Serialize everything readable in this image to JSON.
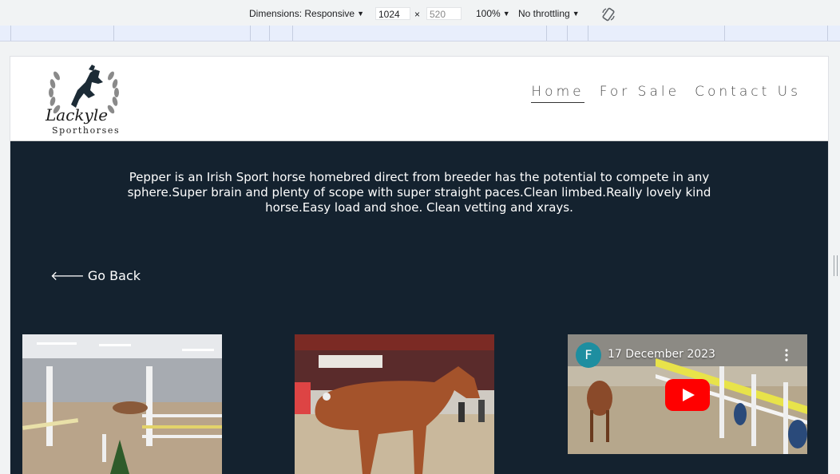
{
  "devtools": {
    "dimensions_label": "Dimensions: Responsive",
    "width": "1024",
    "times": "×",
    "height": "520",
    "zoom": "100%",
    "throttling": "No throttling"
  },
  "site": {
    "logo_text": "Lackyle",
    "logo_sub": "Sporthorses",
    "nav": [
      {
        "label": "Home",
        "active": true
      },
      {
        "label": "For Sale",
        "active": false
      },
      {
        "label": "Contact Us",
        "active": false
      }
    ]
  },
  "main": {
    "description": "Pepper is an Irish Sport horse homebred direct from breeder has the potential to compete in any sphere.Super brain and plenty of scope with super straight paces.Clean limbed.Really lovely kind horse.Easy load and shoe. Clean vetting and xrays.",
    "go_back": "Go Back"
  },
  "video": {
    "channel_initial": "F",
    "title": "17 December 2023",
    "play_color": "#ff0000"
  },
  "colors": {
    "content_bg": "#14222f",
    "header_bg": "#ffffff"
  }
}
